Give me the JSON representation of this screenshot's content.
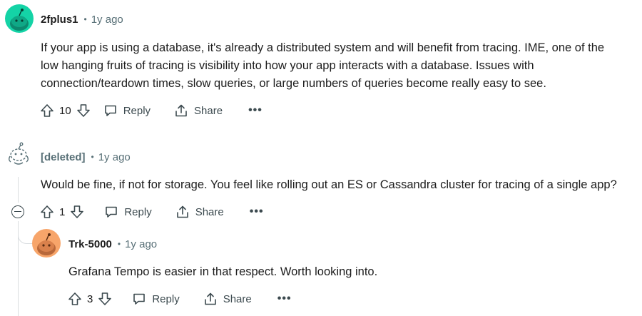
{
  "comments": [
    {
      "author": "2fplus1",
      "time": "1y ago",
      "body_lines": [
        "If your app is using a database, it's already a distributed system and will benefit from tracing. IME, one of the",
        "low hanging fruits of tracing is visibility into how your app interacts with a database. Issues with",
        "connection/teardown times, slow queries, or large numbers of queries become really easy to see."
      ],
      "votes": "10",
      "reply_label": "Reply",
      "share_label": "Share",
      "more_label": "•••",
      "avatar_color": "#14d3a6"
    },
    {
      "author": "[deleted]",
      "time": "1y ago",
      "body_lines": [
        "Would be fine, if not for storage. You feel like rolling out an ES or Cassandra cluster for tracing of a single app?"
      ],
      "votes": "1",
      "reply_label": "Reply",
      "share_label": "Share",
      "more_label": "•••"
    },
    {
      "author": "Trk-5000",
      "time": "1y ago",
      "body_lines": [
        "Grafana Tempo is easier in that respect. Worth looking into."
      ],
      "votes": "3",
      "reply_label": "Reply",
      "share_label": "Share",
      "more_label": "•••",
      "avatar_color": "#f7a56a"
    }
  ],
  "separator": "•",
  "icons": {
    "upvote": "upvote-icon",
    "downvote": "downvote-icon",
    "reply": "comment-bubble-icon",
    "share": "share-icon",
    "collapse": "collapse-icon"
  }
}
